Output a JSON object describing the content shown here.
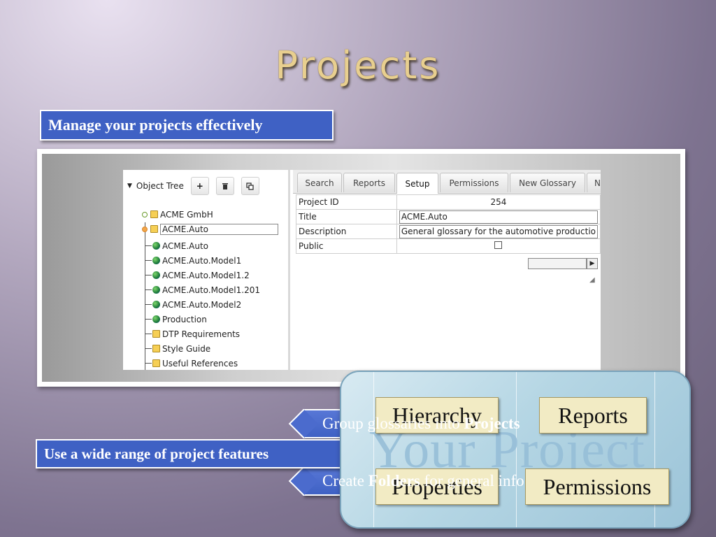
{
  "slide": {
    "title": "Projects",
    "callout_top": "Manage your projects effectively",
    "callout_bottom": "Use a wide range of project features"
  },
  "app": {
    "tree": {
      "header_label": "Object Tree",
      "add_icon": "plus-icon",
      "delete_icon": "trash-icon",
      "copy_icon": "copy-icon",
      "items": [
        {
          "label": "ACME GmbH",
          "icon": "folder-icon"
        },
        {
          "label": "ACME.Auto",
          "icon": "folder-icon"
        },
        {
          "label": "ACME.Auto",
          "icon": "globe-icon"
        },
        {
          "label": "ACME.Auto.Model1",
          "icon": "globe-icon"
        },
        {
          "label": "ACME.Auto.Model1.2",
          "icon": "globe-icon"
        },
        {
          "label": "ACME.Auto.Model1.201",
          "icon": "globe-icon"
        },
        {
          "label": "ACME.Auto.Model2",
          "icon": "globe-icon"
        },
        {
          "label": "Production",
          "icon": "globe-icon"
        },
        {
          "label": "DTP Requirements",
          "icon": "folder-icon"
        },
        {
          "label": "Style Guide",
          "icon": "folder-icon"
        },
        {
          "label": "Useful References",
          "icon": "folder-icon"
        }
      ]
    },
    "tabs": [
      "Search",
      "Reports",
      "Setup",
      "Permissions",
      "New Glossary",
      "N"
    ],
    "active_tab": "Setup",
    "properties": [
      {
        "key": "Project ID",
        "value": "254"
      },
      {
        "key": "Title",
        "value": "ACME.Auto"
      },
      {
        "key": "Description",
        "value": "General glossary for the automotive productio"
      },
      {
        "key": "Public",
        "value": ""
      }
    ]
  },
  "flags": {
    "glossaries_prefix": "Group glossaries into ",
    "glossaries_bold": "Projects",
    "folders_prefix": "Create ",
    "folders_bold": "Folders",
    "folders_suffix": " for general info"
  },
  "features": {
    "watermark": "Your Project",
    "hierarchy": "Hierarchy",
    "reports": "Reports",
    "properties": "Properties",
    "permissions": "Permissions"
  },
  "colors": {
    "callout_blue": "#3f61c4",
    "title_gold": "#e8cf8f",
    "panel_blue": "#b5d6e4",
    "feature_cream": "#f2ebc4"
  }
}
